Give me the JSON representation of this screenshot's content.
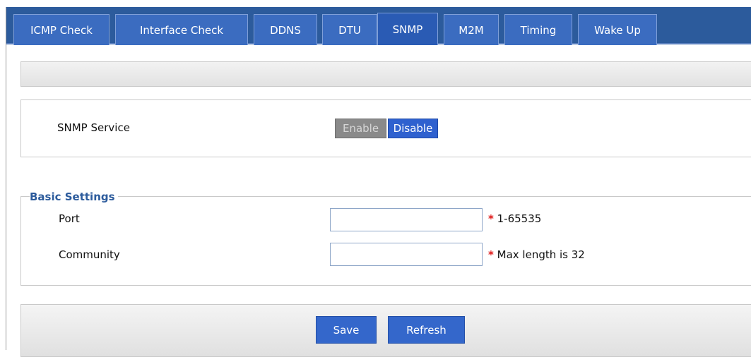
{
  "tabs": [
    {
      "label": "ICMP Check"
    },
    {
      "label": "Interface Check"
    },
    {
      "label": "DDNS"
    },
    {
      "label": "DTU"
    },
    {
      "label": "SNMP"
    },
    {
      "label": "M2M"
    },
    {
      "label": "Timing"
    },
    {
      "label": "Wake Up"
    }
  ],
  "active_tab": "SNMP",
  "service": {
    "label": "SNMP Service",
    "enable_label": "Enable",
    "disable_label": "Disable",
    "selected": "Disable"
  },
  "basic_settings": {
    "legend": "Basic Settings",
    "port": {
      "label": "Port",
      "value": "",
      "required_mark": "*",
      "hint": "1-65535"
    },
    "community": {
      "label": "Community",
      "value": "",
      "required_mark": "*",
      "hint": "Max length is 32"
    }
  },
  "actions": {
    "save_label": "Save",
    "refresh_label": "Refresh"
  },
  "colors": {
    "tab_bar": "#2c5b9c",
    "tab": "#3b6cc0",
    "accent_button": "#3467cb",
    "legend": "#2c5b9c",
    "required": "#e01b1b",
    "disabled_button": "#8a8a8a"
  }
}
